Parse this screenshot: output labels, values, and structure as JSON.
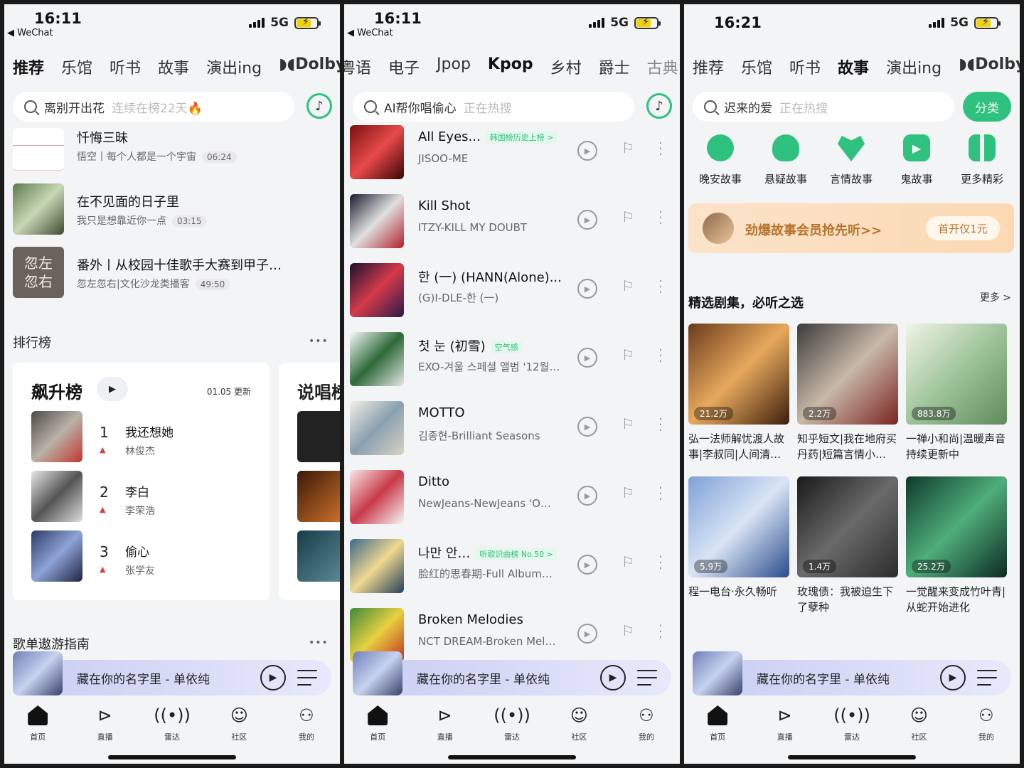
{
  "colors": {
    "accent": "#2ec27e",
    "rank_up": "#e23b3b"
  },
  "p1": {
    "status": {
      "time": "16:11",
      "back": "◀ WeChat",
      "network": "5G"
    },
    "tabs": [
      {
        "label": "推荐",
        "active": true
      },
      {
        "label": "乐馆"
      },
      {
        "label": "听书"
      },
      {
        "label": "故事"
      },
      {
        "label": "演出ing"
      },
      {
        "label": "◗◖Dolby"
      }
    ],
    "search": {
      "text": "离别开出花",
      "hint": "连续在榜22天🔥"
    },
    "list": [
      {
        "title": "忏悔三昧",
        "sub": "悟空丨每个人都是一个宇宙",
        "dur": "06:24"
      },
      {
        "title": "在不见面的日子里",
        "sub": "我只是想靠近你一点",
        "dur": "03:15"
      },
      {
        "title": "番外丨从校园十佳歌手大赛到甲子…",
        "sub": "忽左忽右|文化沙龙类播客",
        "dur": "49:50",
        "cover": "忽左\n忽右"
      }
    ],
    "ranking": {
      "heading": "排行榜",
      "more": "•••",
      "card_title": "飙升榜",
      "update": "01.05 更新",
      "peek_title": "说唱榜",
      "rows": [
        {
          "rank": "1",
          "title": "我还想她",
          "artist": "林俊杰"
        },
        {
          "rank": "2",
          "title": "李白",
          "artist": "李荣浩"
        },
        {
          "rank": "3",
          "title": "偷心",
          "artist": "张学友"
        }
      ]
    },
    "guide": {
      "heading": "歌单遨游指南",
      "more": "•••"
    }
  },
  "p2": {
    "status": {
      "time": "16:11",
      "back": "◀ WeChat",
      "network": "5G"
    },
    "tabs": [
      {
        "label": "粤语"
      },
      {
        "label": "电子"
      },
      {
        "label": "Jpop"
      },
      {
        "label": "Kpop",
        "active": true
      },
      {
        "label": "乡村"
      },
      {
        "label": "爵士"
      },
      {
        "label": "古典"
      }
    ],
    "search": {
      "text": "AI帮你唱偷心",
      "hint": "正在热搜"
    },
    "songs": [
      {
        "title": "All Eyes...",
        "tag": "韩国榜历史上榜 >",
        "artist": "JISOO-ME"
      },
      {
        "title": "Kill Shot",
        "artist": "ITZY-KILL MY DOUBT"
      },
      {
        "title": "한 (一) (HANN(Alone)...",
        "artist": "(G)I-DLE-한 (一)"
      },
      {
        "title": "첫 눈 (初雪)",
        "tag": "空气感",
        "artist": "EXO-겨울 스페셜 앨범 '12월…"
      },
      {
        "title": "MOTTO",
        "artist": "김종현-Brilliant Seasons"
      },
      {
        "title": "Ditto",
        "artist": "NewJeans-NewJeans 'O…"
      },
      {
        "title": "나만 안…",
        "tag": "听歌识曲榜 No.50 >",
        "artist": "脸红的思春期-Full Album…"
      },
      {
        "title": "Broken Melodies",
        "artist": "NCT DREAM-Broken Mel…"
      }
    ]
  },
  "p3": {
    "status": {
      "time": "16:21",
      "network": "5G"
    },
    "tabs": [
      {
        "label": "推荐"
      },
      {
        "label": "乐馆"
      },
      {
        "label": "听书"
      },
      {
        "label": "故事",
        "active": true
      },
      {
        "label": "演出ing"
      },
      {
        "label": "◗◖Dolby"
      }
    ],
    "search": {
      "text": "迟来的爱",
      "hint": "正在热搜"
    },
    "classify": "分类",
    "cats": [
      {
        "label": "晚安故事",
        "icon": "moon-face-icon"
      },
      {
        "label": "悬疑故事",
        "icon": "detective-icon"
      },
      {
        "label": "言情故事",
        "icon": "heart-icon"
      },
      {
        "label": "鬼故事",
        "icon": "play-square-icon"
      },
      {
        "label": "更多精彩",
        "icon": "grid-icon"
      }
    ],
    "banner": {
      "text": "劲爆故事会员抢先听>>",
      "btn": "首开仅1元"
    },
    "section": {
      "title": "精选剧集，必听之选",
      "more": "更多 >"
    },
    "posters": [
      {
        "count": "21.2万",
        "text": "弘一法师解忧渡人故事|李叔同|人间清…"
      },
      {
        "count": "2.2万",
        "text": "知乎短文|我在地府买丹药|短篇言情小…"
      },
      {
        "count": "883.8万",
        "text": "一禅小和尚|温暖声音持续更新中"
      },
      {
        "count": "5.9万",
        "text": "程一电台·永久畅听"
      },
      {
        "count": "1.4万",
        "text": "玫瑰债：我被迫生下了孽种"
      },
      {
        "count": "25.2万",
        "text": "一觉醒来变成竹叶青|从蛇开始进化"
      }
    ]
  },
  "player": {
    "title": "藏在你的名字里 - 单依纯"
  },
  "nav": [
    {
      "label": "首页"
    },
    {
      "label": "直播"
    },
    {
      "label": "雷达"
    },
    {
      "label": "社区"
    },
    {
      "label": "我的"
    }
  ]
}
